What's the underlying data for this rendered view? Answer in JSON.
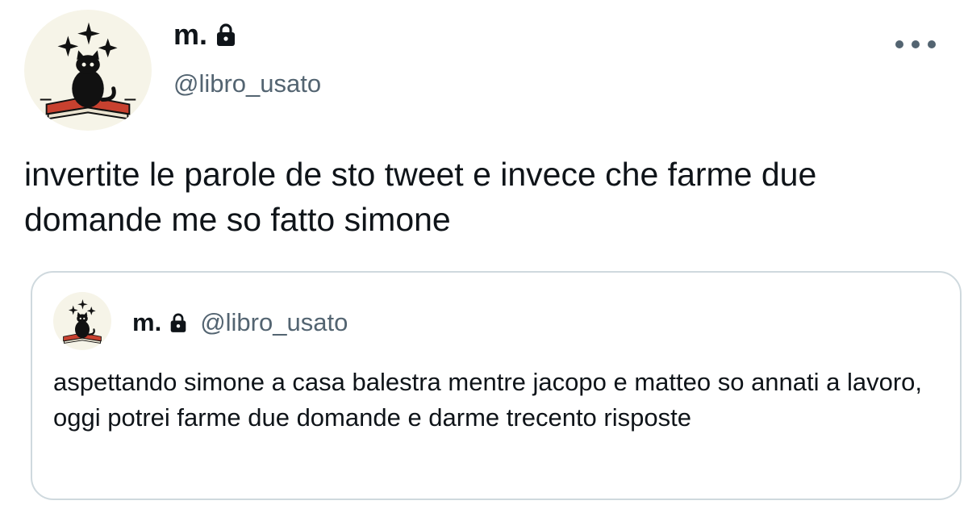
{
  "tweet": {
    "author": {
      "display_name": "m.",
      "handle": "@libro_usato",
      "protected_icon": "lock-icon",
      "avatar_icon": "black-cat-on-book-with-sparkles"
    },
    "more_icon": "more-horizontal-icon",
    "text": "invertite le parole de sto tweet e invece che farme due domande me so fatto simone"
  },
  "quoted_tweet": {
    "author": {
      "display_name": "m.",
      "handle": "@libro_usato",
      "protected_icon": "lock-icon"
    },
    "text": "aspettando simone a casa balestra mentre jacopo e matteo so annati a lavoro, oggi potrei farme due domande e darme trecento risposte"
  },
  "colors": {
    "text_primary": "#0f1419",
    "text_secondary": "#536471",
    "border": "#cfd9de",
    "avatar_bg": "#f6f4e8",
    "book_red": "#c8412f"
  }
}
